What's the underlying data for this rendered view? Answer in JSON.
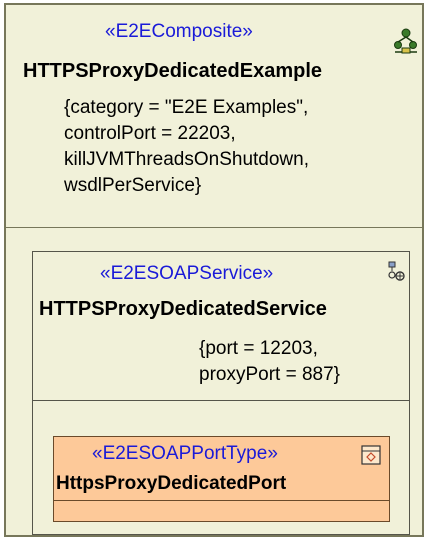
{
  "composite": {
    "stereotype": "«E2EComposite»",
    "name": "HTTPSProxyDedicatedExample",
    "tags": [
      "{category = \"E2E Examples\",",
      "controlPort = 22203,",
      "killJVMThreadsOnShutdown,",
      "wsdlPerService}"
    ],
    "icon": "composite-icon"
  },
  "service": {
    "stereotype": "«E2ESOAPService»",
    "name": "HTTPSProxyDedicatedService",
    "tags": [
      "{port = 12203,",
      "proxyPort = 887}"
    ],
    "icon": "soap-service-icon"
  },
  "port": {
    "stereotype": "«E2ESOAPPortType»",
    "name": "HttpsProxyDedicatedPort",
    "icon": "port-type-icon"
  },
  "colors": {
    "frame_fill": "#f1f1d9",
    "port_fill": "#fdc999",
    "stereotype_text": "#1a1ad8"
  }
}
